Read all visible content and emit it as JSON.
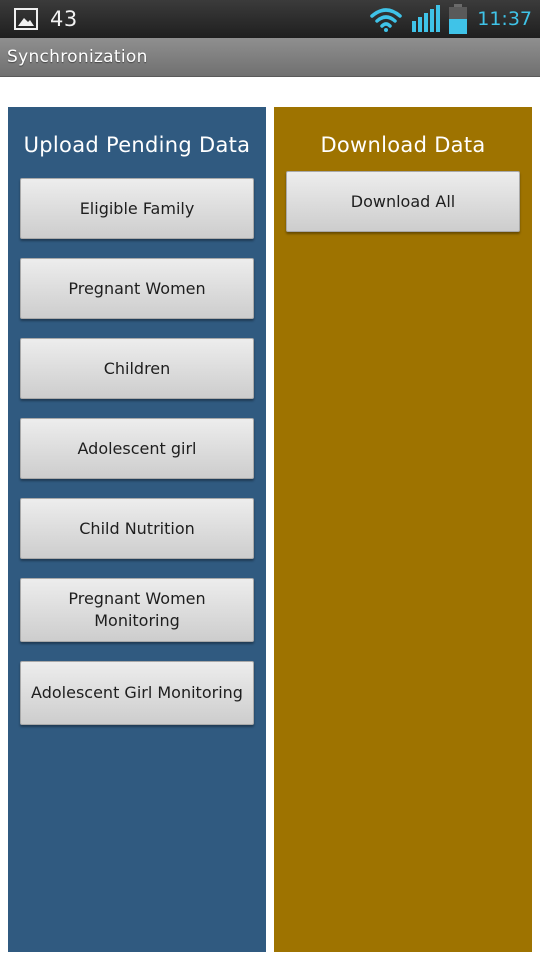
{
  "status_bar": {
    "notification_count": "43",
    "time": "11:37",
    "icons": [
      "gallery-icon",
      "wifi-icon",
      "signal-icon",
      "battery-icon"
    ]
  },
  "title_bar": {
    "title": "Synchronization"
  },
  "upload_panel": {
    "title": "Upload Pending Data",
    "background": "#305a80",
    "buttons": [
      {
        "label": "Eligible Family"
      },
      {
        "label": "Pregnant Women"
      },
      {
        "label": "Children"
      },
      {
        "label": "Adolescent girl"
      },
      {
        "label": "Child Nutrition"
      },
      {
        "label": "Pregnant Women Monitoring"
      },
      {
        "label": "Adolescent Girl Monitoring"
      }
    ]
  },
  "download_panel": {
    "title": "Download Data",
    "background": "#9e7300",
    "buttons": [
      {
        "label": "Download All"
      }
    ]
  }
}
